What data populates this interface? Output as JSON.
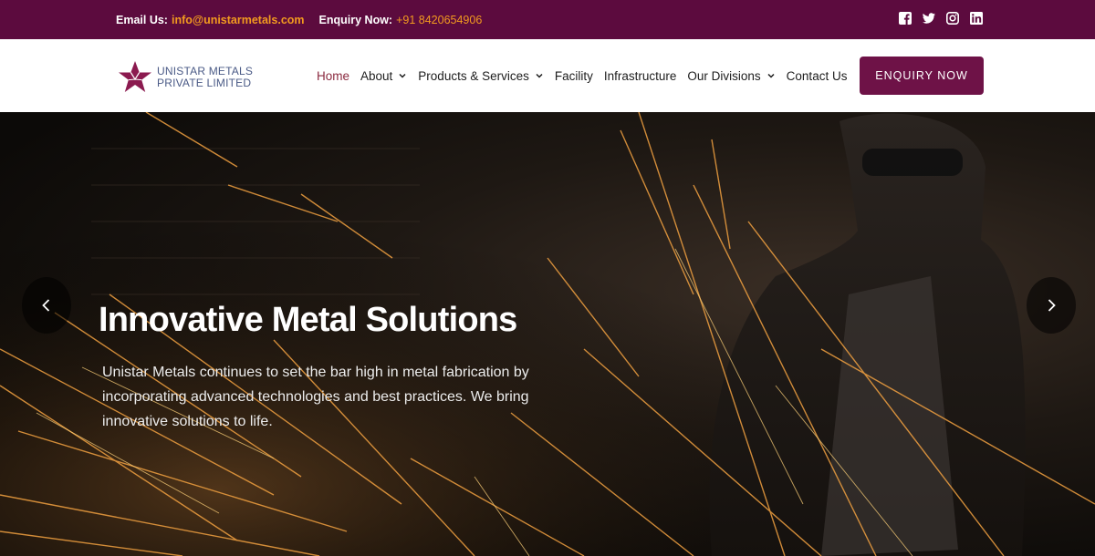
{
  "topbar": {
    "email_label": "Email Us:",
    "email_value": "info@unistarmetals.com",
    "phone_label": "Enquiry Now:",
    "phone_value": "+91 8420654906",
    "social": [
      "facebook-icon",
      "twitter-icon",
      "instagram-icon",
      "linkedin-icon"
    ]
  },
  "logo": {
    "line1": "UNISTAR METALS",
    "line2": "PRIVATE LIMITED"
  },
  "nav": {
    "items": [
      {
        "label": "Home",
        "active": true
      },
      {
        "label": "About",
        "dropdown": true
      },
      {
        "label": "Products & Services",
        "dropdown": true
      },
      {
        "label": "Facility"
      },
      {
        "label": "Infrastructure"
      },
      {
        "label": "Our Divisions",
        "dropdown": true
      },
      {
        "label": "Contact Us"
      }
    ],
    "cta": "ENQUIRY NOW"
  },
  "hero": {
    "title": "Innovative Metal Solutions",
    "description": "Unistar Metals continues to set the bar high in metal fabrication by incorporating advanced technologies and best practices. We bring innovative solutions to life."
  },
  "colors": {
    "topbar_bg": "#5c0b3e",
    "accent": "#f29a1f",
    "cta_bg": "#6e1247",
    "active_nav": "#8b2a3f",
    "logo_star": "#8b1a4f"
  }
}
